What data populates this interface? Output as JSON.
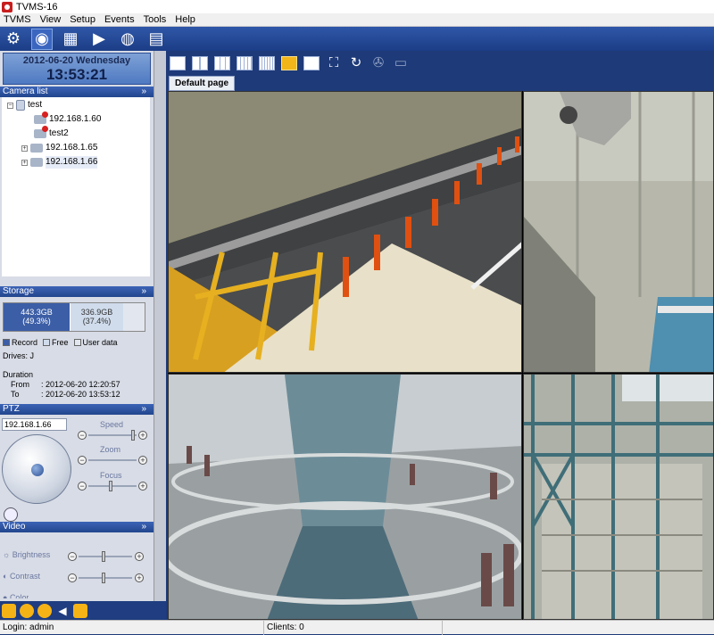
{
  "window": {
    "title": "TVMS-16"
  },
  "menu": [
    "TVMS",
    "View",
    "Setup",
    "Events",
    "Tools",
    "Help"
  ],
  "toolbar": {
    "buttons": [
      {
        "name": "settings-gear-icon"
      },
      {
        "name": "live-view-icon",
        "active": true
      },
      {
        "name": "filmstrip-icon"
      },
      {
        "name": "playback-icon"
      },
      {
        "name": "globe-icon"
      },
      {
        "name": "document-icon"
      }
    ]
  },
  "clock": {
    "date": "2012-06-20 Wednesday",
    "time": "13:53:21"
  },
  "camera_list": {
    "title": "Camera list",
    "root": "test",
    "items": [
      {
        "label": "192.168.1.60",
        "error": true
      },
      {
        "label": "test2",
        "error": true
      },
      {
        "label": "192.168.1.65",
        "error": false
      },
      {
        "label": "192.168.1.66",
        "error": false,
        "selected": true
      }
    ]
  },
  "storage": {
    "title": "Storage",
    "record": {
      "size": "443.3GB",
      "pct": "(49.3%)"
    },
    "free": {
      "size": "336.9GB",
      "pct": "(37.4%)"
    },
    "legend": {
      "record": "Record",
      "free": "Free",
      "user": "User data"
    },
    "drives": "Drives: J",
    "duration_label": "Duration",
    "from_label": "From",
    "from_value": ": 2012-06-20 12:20:57",
    "to_label": "To",
    "to_value": ": 2012-06-20 13:53:12"
  },
  "ptz": {
    "title": "PTZ",
    "camera": "192.168.1.66",
    "speed": "Speed",
    "zoom": "Zoom",
    "focus": "Focus",
    "preset": ""
  },
  "video": {
    "title": "Video",
    "brightness": "Brightness",
    "contrast": "Contrast",
    "color": "Color"
  },
  "tabs": {
    "default_page": "Default page"
  },
  "status": {
    "login": "Login: admin",
    "clients": "Clients: 0"
  },
  "colors": {
    "accent": "#f2b51a",
    "panel_header": "#2a4f9e",
    "window_bg": "#1e3a78"
  }
}
